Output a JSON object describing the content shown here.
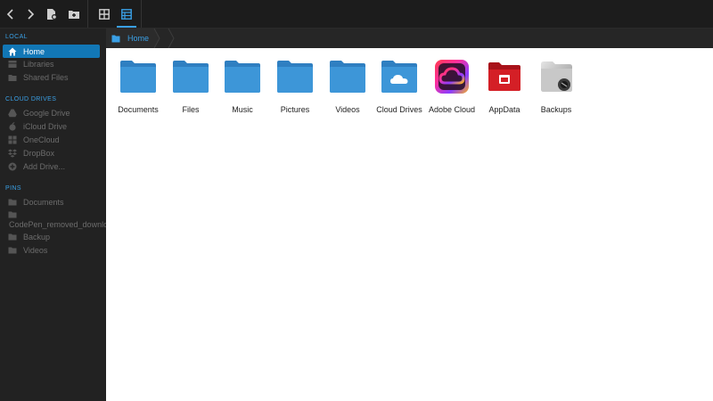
{
  "toolbar": {
    "buttons": [
      {
        "name": "back-button",
        "icon": "chevron-left-icon"
      },
      {
        "name": "forward-button",
        "icon": "chevron-right-icon"
      },
      {
        "name": "new-file-button",
        "icon": "file-settings-icon"
      },
      {
        "name": "new-folder-button",
        "icon": "folder-add-icon"
      },
      {
        "name": "grid-view-button",
        "icon": "grid-icon"
      },
      {
        "name": "details-view-button",
        "icon": "table-icon"
      }
    ],
    "active_view": "details-view-button"
  },
  "sidebar": {
    "local": {
      "title": "LOCAL",
      "items": [
        {
          "label": "Home",
          "icon": "home-icon",
          "active": true
        },
        {
          "label": "Libraries",
          "icon": "library-icon"
        },
        {
          "label": "Shared Files",
          "icon": "shared-folder-icon"
        }
      ]
    },
    "cloud": {
      "title": "CLOUD DRIVES",
      "items": [
        {
          "label": "Google Drive",
          "icon": "google-drive-icon"
        },
        {
          "label": "iCloud Drive",
          "icon": "apple-icon"
        },
        {
          "label": "OneCloud",
          "icon": "windows-icon"
        },
        {
          "label": "DropBox",
          "icon": "dropbox-icon"
        },
        {
          "label": "Add Drive...",
          "icon": "plus-circle-icon"
        }
      ]
    },
    "pins": {
      "title": "PINS",
      "items": [
        {
          "label": "Documents",
          "icon": "folder-icon"
        },
        {
          "label": "CodePen_removed_downloa",
          "icon": "folder-icon"
        },
        {
          "label": "Backup",
          "icon": "folder-icon"
        },
        {
          "label": "Videos",
          "icon": "folder-icon"
        }
      ]
    }
  },
  "breadcrumb": {
    "items": [
      {
        "label": "Home",
        "icon": "folder-icon"
      }
    ]
  },
  "files": [
    {
      "name": "Documents",
      "icon": "folder-icon"
    },
    {
      "name": "Files",
      "icon": "folder-icon"
    },
    {
      "name": "Music",
      "icon": "folder-icon"
    },
    {
      "name": "Pictures",
      "icon": "folder-icon"
    },
    {
      "name": "Videos",
      "icon": "folder-icon"
    },
    {
      "name": "Cloud Drives",
      "icon": "cloud-folder-icon"
    },
    {
      "name": "Adobe Cloud",
      "icon": "adobe-creative-cloud-icon"
    },
    {
      "name": "AppData",
      "icon": "red-folder-icon"
    },
    {
      "name": "Backups",
      "icon": "backup-drive-icon"
    }
  ],
  "colors": {
    "accent": "#3aa0e6",
    "active_item": "#1277b6",
    "folder": "#3d96d8",
    "sidebar_bg": "#222222",
    "toolbar_bg": "#1c1c1c"
  }
}
